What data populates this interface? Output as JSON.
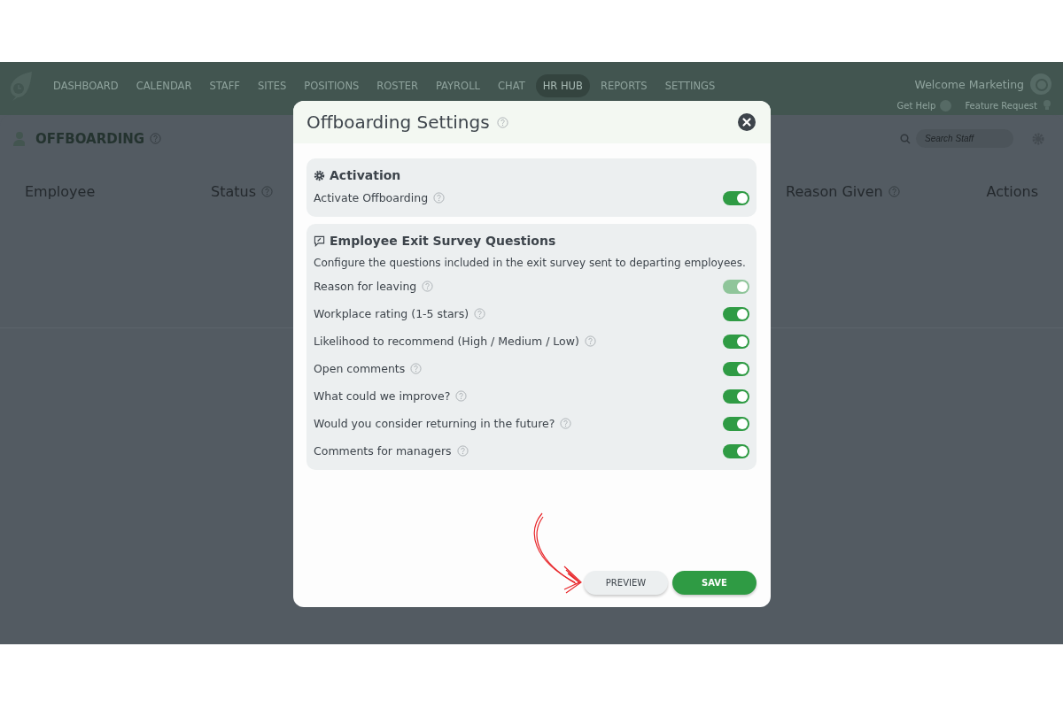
{
  "nav": {
    "items": [
      {
        "label": "DASHBOARD",
        "selected": false
      },
      {
        "label": "CALENDAR",
        "selected": false
      },
      {
        "label": "STAFF",
        "selected": false
      },
      {
        "label": "SITES",
        "selected": false
      },
      {
        "label": "POSITIONS",
        "selected": false
      },
      {
        "label": "ROSTER",
        "selected": false
      },
      {
        "label": "PAYROLL",
        "selected": false
      },
      {
        "label": "CHAT",
        "selected": false
      },
      {
        "label": "HR HUB",
        "selected": true
      },
      {
        "label": "REPORTS",
        "selected": false
      },
      {
        "label": "SETTINGS",
        "selected": false
      }
    ],
    "welcome": "Welcome Marketing",
    "get_help": "Get Help",
    "feature_request": "Feature Request"
  },
  "page": {
    "title": "OFFBOARDING",
    "search": {
      "placeholder": "Search Staff"
    },
    "columns": [
      {
        "label": "Employee",
        "help": false
      },
      {
        "label": "Status",
        "help": true
      },
      {
        "label": "Reason Given",
        "help": true
      },
      {
        "label": "Actions",
        "help": false
      }
    ]
  },
  "modal": {
    "title": "Offboarding Settings",
    "activation": {
      "title": "Activation",
      "rows": [
        {
          "label": "Activate Offboarding",
          "on": true,
          "disabled": false
        }
      ]
    },
    "survey": {
      "title": "Employee Exit Survey Questions",
      "description": "Configure the questions included in the exit survey sent to departing employees.",
      "rows": [
        {
          "label": "Reason for leaving",
          "on": true,
          "disabled": true
        },
        {
          "label": "Workplace rating (1-5 stars)",
          "on": true,
          "disabled": false
        },
        {
          "label": "Likelihood to recommend (High / Medium / Low)",
          "on": true,
          "disabled": false
        },
        {
          "label": "Open comments",
          "on": true,
          "disabled": false
        },
        {
          "label": "What could we improve?",
          "on": true,
          "disabled": false
        },
        {
          "label": "Would you consider returning in the future?",
          "on": true,
          "disabled": false
        },
        {
          "label": "Comments for managers",
          "on": true,
          "disabled": false
        }
      ]
    },
    "buttons": [
      {
        "label": "PREVIEW",
        "kind": "secondary"
      },
      {
        "label": "SAVE",
        "kind": "primary"
      }
    ]
  }
}
